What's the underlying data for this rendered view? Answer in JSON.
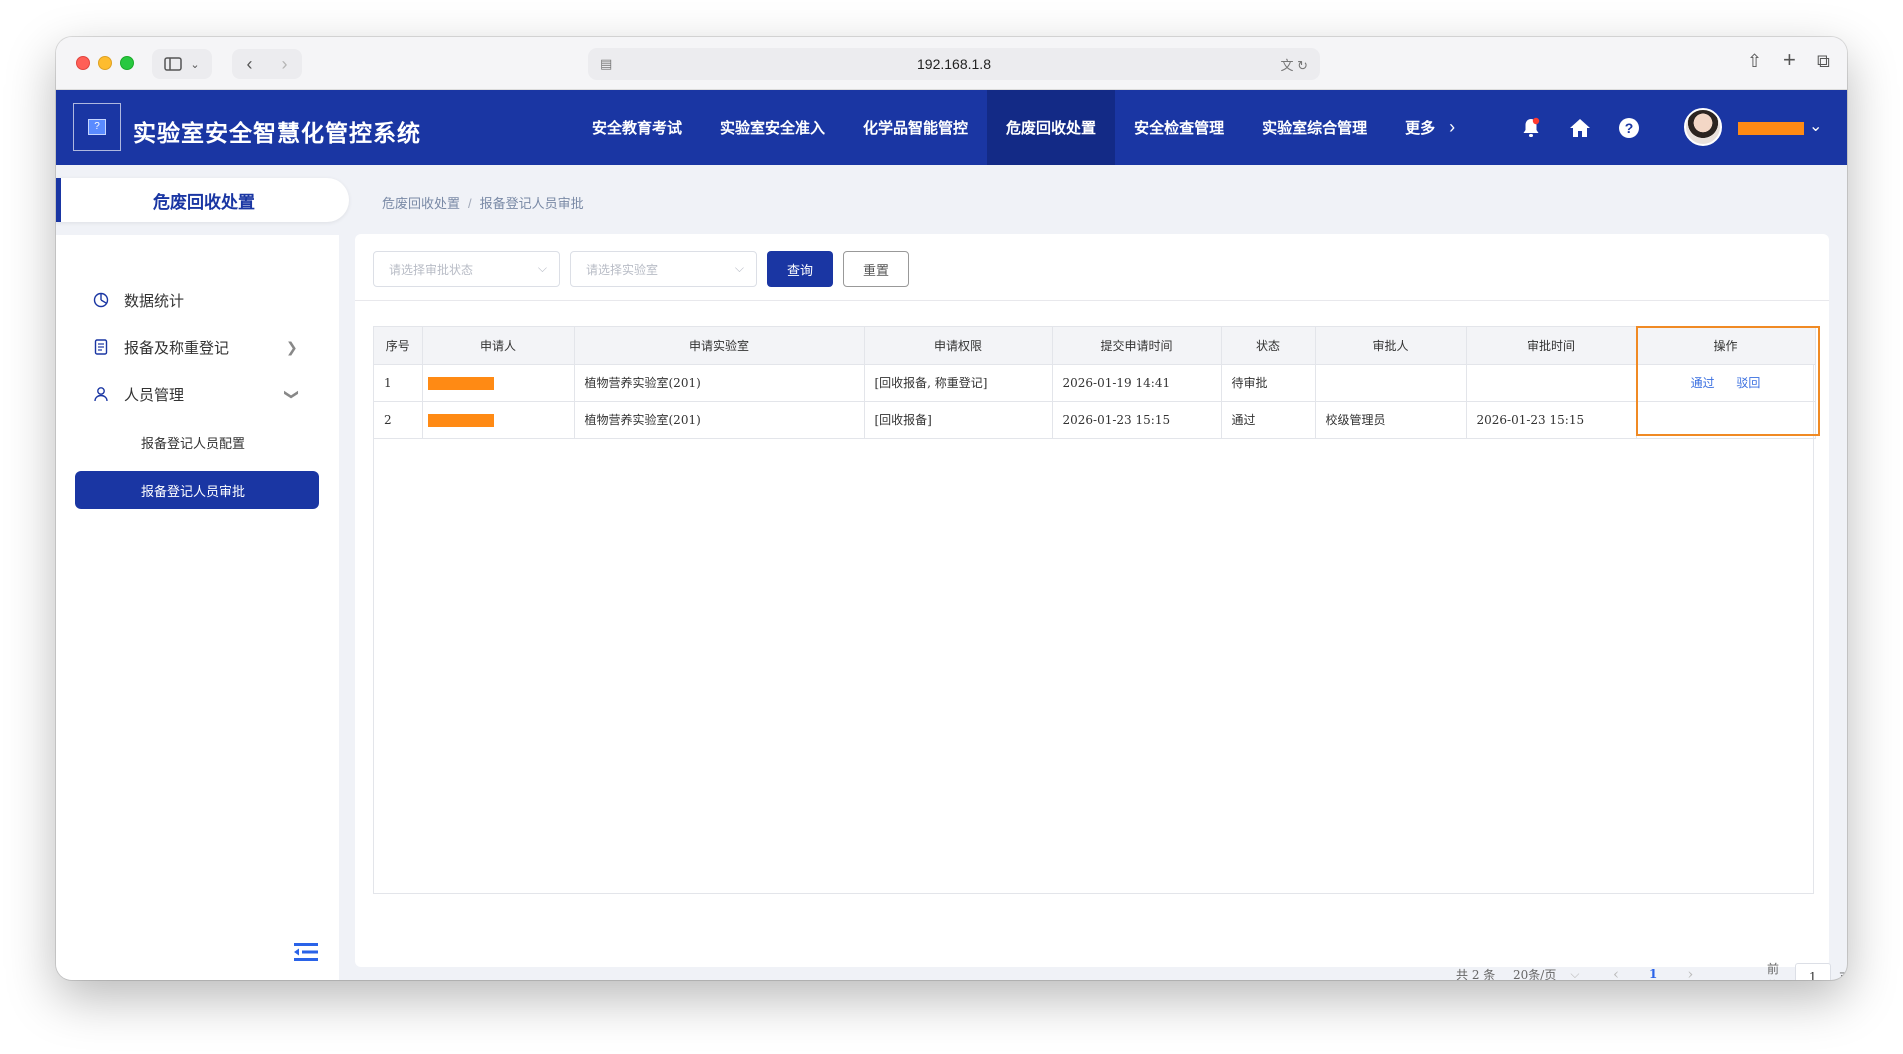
{
  "browser": {
    "url": "192.168.1.8"
  },
  "header": {
    "logo_glyph": "?",
    "title": "实验室安全智慧化管控系统",
    "nav": [
      {
        "label": "安全教育考试"
      },
      {
        "label": "实验室安全准入"
      },
      {
        "label": "化学品智能管控"
      },
      {
        "label": "危废回收处置",
        "active": true
      },
      {
        "label": "安全检查管理"
      },
      {
        "label": "实验室综合管理"
      },
      {
        "label": "更多"
      }
    ],
    "icons": [
      "bell-icon",
      "home-icon",
      "help-icon"
    ],
    "notification_dot_color": "#ff3b30",
    "username_redacted_color": "#ff8a14"
  },
  "sidebar": {
    "section_title": "危废回收处置",
    "items": [
      {
        "label": "数据统计",
        "icon": "pie-chart-icon"
      },
      {
        "label": "报备及称重登记",
        "icon": "document-icon",
        "expandable": true
      },
      {
        "label": "人员管理",
        "icon": "user-icon",
        "expanded": true,
        "children": [
          {
            "label": "报备登记人员配置"
          },
          {
            "label": "报备登记人员审批",
            "active": true
          }
        ]
      }
    ]
  },
  "breadcrumb": [
    "危废回收处置",
    "报备登记人员审批"
  ],
  "filters": {
    "status_placeholder": "请选择审批状态",
    "lab_placeholder": "请选择实验室",
    "search_label": "查询",
    "reset_label": "重置"
  },
  "table": {
    "columns": [
      "序号",
      "申请人",
      "申请实验室",
      "申请权限",
      "提交申请时间",
      "状态",
      "审批人",
      "审批时间",
      "操作"
    ],
    "rows": [
      {
        "index": "1",
        "applicant": "[redacted]",
        "lab": "植物营养实验室(201)",
        "permission": "[回收报备, 称重登记]",
        "submitted": "2026-01-19 14:41",
        "status": "待审批",
        "approver": "",
        "approved_at": "",
        "actions": [
          "通过",
          "驳回"
        ]
      },
      {
        "index": "2",
        "applicant": "[redacted]",
        "lab": "植物营养实验室(201)",
        "permission": "[回收报备]",
        "submitted": "2026-01-23 15:15",
        "status": "通过",
        "approver": "校级管理员",
        "approved_at": "2026-01-23 15:15",
        "actions": []
      }
    ]
  },
  "pagination": {
    "total": "共 2 条",
    "page_size": "20条/页",
    "current_page": "1",
    "goto_prefix": "前往",
    "goto_value": "1",
    "goto_suffix": "页"
  },
  "colors": {
    "primary": "#1a36a3",
    "highlight_border": "#f08a24",
    "link": "#3a6fe0"
  }
}
